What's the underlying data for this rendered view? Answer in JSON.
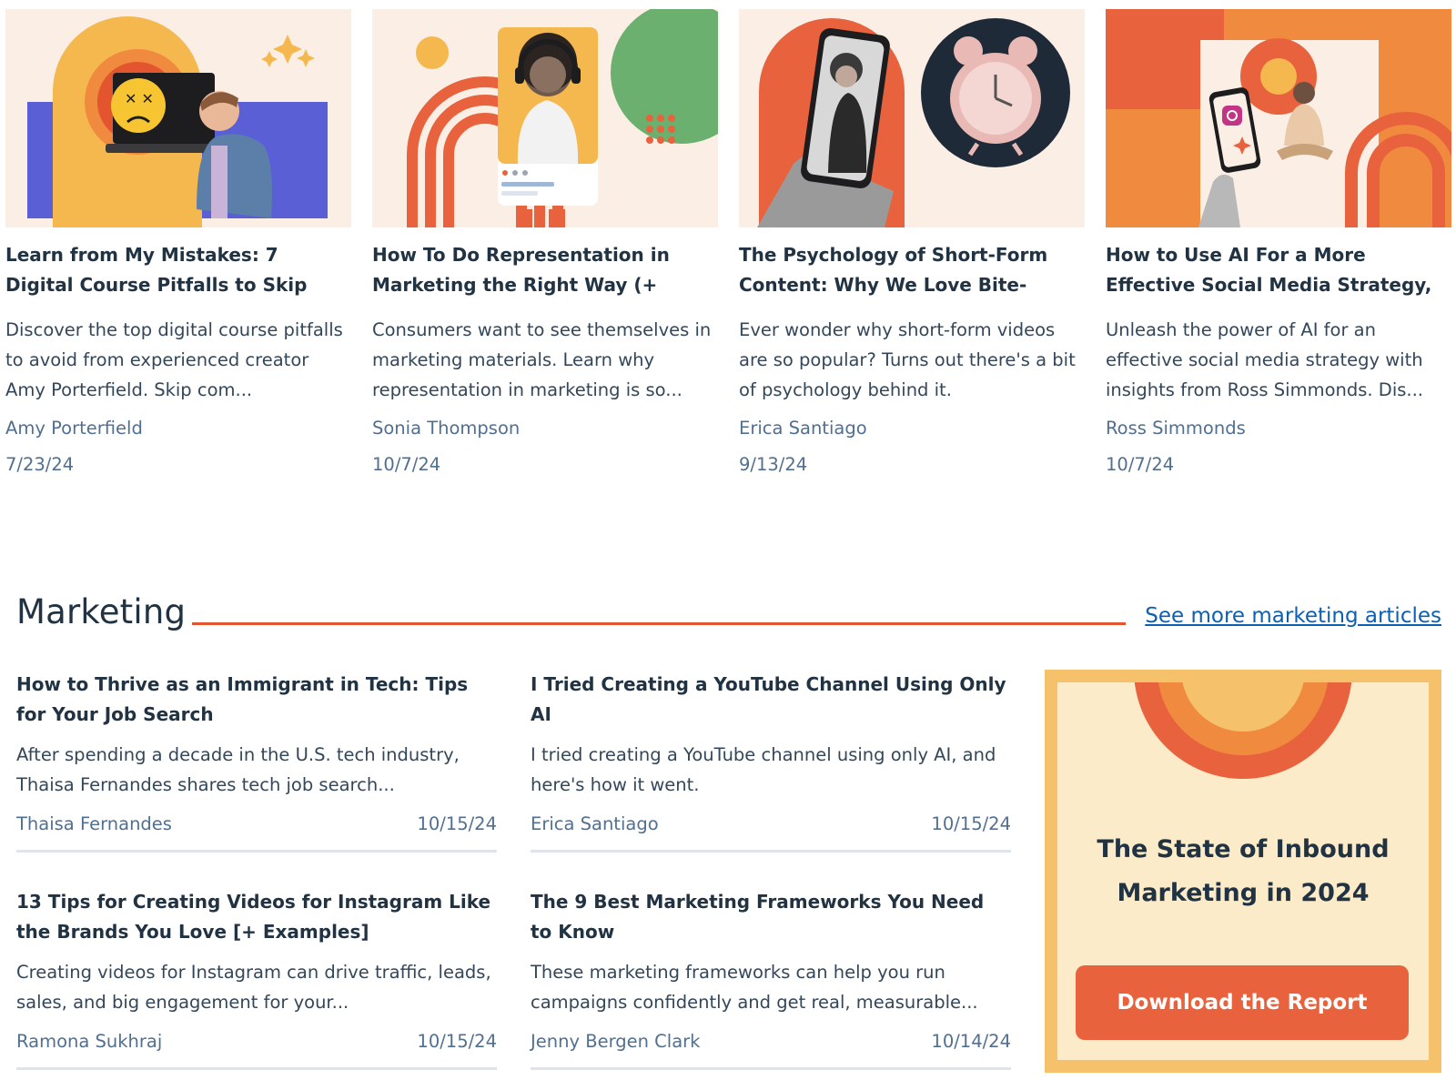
{
  "cards": [
    {
      "title": "Learn from My Mistakes: 7 Digital Course Pitfalls to Skip",
      "description": "Discover the top digital course pitfalls to avoid from experienced creator Amy Porterfield. Skip com...",
      "author": "Amy Porterfield",
      "date": "7/23/24",
      "image": "laptop-frown-illustration"
    },
    {
      "title": "How To Do Representation in Marketing the Right Way (+ Consu...",
      "description": "Consumers want to see themselves in marketing materials. Learn why representation in marketing is so...",
      "author": "Sonia Thompson",
      "date": "10/7/24",
      "image": "headphones-phone-illustration"
    },
    {
      "title": "The Psychology of Short-Form Content: Why We Love Bite-Sized...",
      "description": "Ever wonder why short-form videos are so popular? Turns out there's a bit of psychology behind it.",
      "author": "Erica Santiago",
      "date": "9/13/24",
      "image": "phone-alarm-clock-illustration"
    },
    {
      "title": "How to Use AI For a More Effective Social Media Strategy, Ac...",
      "description": "Unleash the power of AI for an effective social media strategy with insights from Ross Simmonds. Dis...",
      "author": "Ross Simmonds",
      "date": "10/7/24",
      "image": "instagram-phone-illustration"
    }
  ],
  "marketing": {
    "heading": "Marketing",
    "see_more": "See more marketing articles",
    "articles": [
      {
        "title": "How to Thrive as an Immigrant in Tech: Tips for Your Job Search",
        "description": "After spending a decade in the U.S. tech industry, Thaisa Fernandes shares tech job search...",
        "author": "Thaisa Fernandes",
        "date": "10/15/24"
      },
      {
        "title": "I Tried Creating a YouTube Channel Using Only AI",
        "description": "I tried creating a YouTube channel using only AI, and here's how it went.",
        "author": "Erica Santiago",
        "date": "10/15/24"
      },
      {
        "title": "13 Tips for Creating Videos for Instagram Like the Brands You Love [+ Examples]",
        "description": "Creating videos for Instagram can drive traffic, leads, sales, and big engagement for your...",
        "author": "Ramona Sukhraj",
        "date": "10/15/24"
      },
      {
        "title": "The 9 Best Marketing Frameworks You Need to Know",
        "description": "These marketing frameworks can help you run campaigns confidently and get real, measurable...",
        "author": "Jenny Bergen Clark",
        "date": "10/14/24"
      }
    ]
  },
  "promo": {
    "title": "The State of Inbound Marketing in 2024",
    "button": "Download the Report"
  },
  "colors": {
    "accent_orange": "#e8623d",
    "link_blue": "#0d5fb0",
    "heading_navy": "#213343",
    "meta_slate": "#516f90",
    "promo_border": "#f5c26b",
    "promo_bg": "#fcebc8"
  }
}
